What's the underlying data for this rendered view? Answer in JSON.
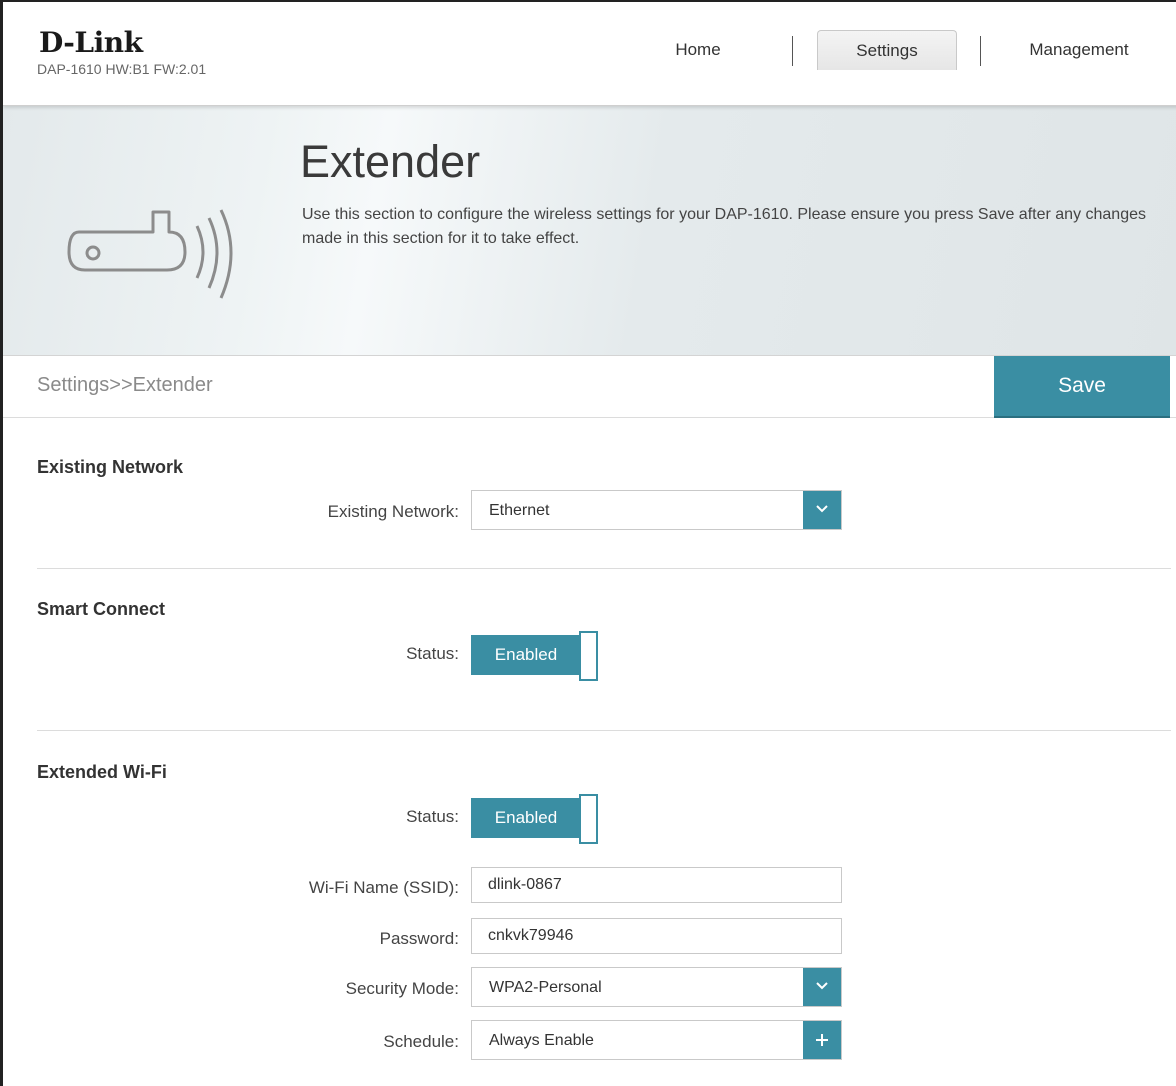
{
  "header": {
    "logo": "D-Link",
    "model_info": "DAP-1610 HW:B1 FW:2.01",
    "nav": {
      "home": "Home",
      "settings": "Settings",
      "management": "Management"
    }
  },
  "banner": {
    "title": "Extender",
    "description": "Use this section to configure the wireless settings for your DAP-1610. Please ensure you press Save after any changes made in this section for it to take effect.",
    "icon": "wireless-extender-icon"
  },
  "breadcrumb": "Settings>>Extender",
  "save_label": "Save",
  "existing_network": {
    "title": "Existing Network",
    "label": "Existing Network:",
    "value": "Ethernet"
  },
  "smart_connect": {
    "title": "Smart Connect",
    "status_label": "Status:",
    "status_value": "Enabled"
  },
  "extended_wifi": {
    "title": "Extended Wi-Fi",
    "status_label": "Status:",
    "status_value": "Enabled",
    "ssid_label": "Wi-Fi Name (SSID):",
    "ssid_value": "dlink-0867",
    "password_label": "Password:",
    "password_value": "cnkvk79946",
    "security_label": "Security Mode:",
    "security_value": "WPA2-Personal",
    "schedule_label": "Schedule:",
    "schedule_value": "Always Enable"
  },
  "colors": {
    "accent": "#3a8ea3",
    "banner_bg": "#e3e9eb"
  }
}
